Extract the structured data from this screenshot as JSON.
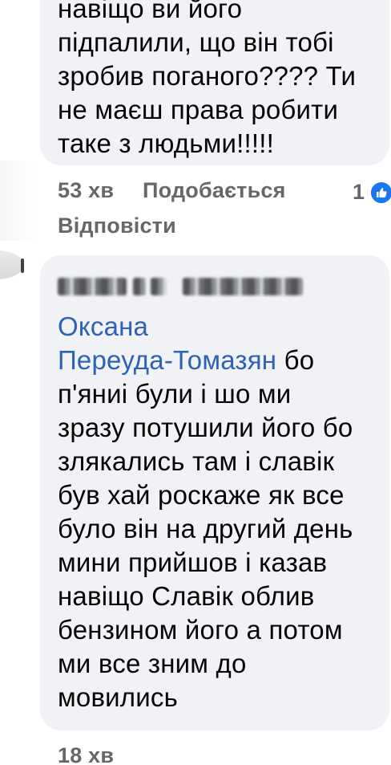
{
  "comment_1": {
    "text": "навіщо ви його\nпідпалили, що він тобі\nзробив поганого???? Ти\nне маєш права робити\nтаке з людьми!!!!!",
    "time": "53 хв",
    "like_label": "Подобається",
    "reply_label": "Відповісти",
    "reaction_count": "1"
  },
  "comment_2": {
    "mention": "Оксана\nПереуда-Томазян",
    "text": " бо\nп'яниі були і шо ми\nзразу потушили його бо\nзлякались там і славік\nбув хай роскаже як все\nбуло він на другий день\nмини прийшов і казав\nнавіщо Славік облив\nбензином його а потом\nми все зним до\nмовились",
    "time": "18 хв"
  },
  "colors": {
    "bubble": "#f0f2f5",
    "text": "#050505",
    "meta": "#65676b",
    "mention": "#2d62b6",
    "like": "#1877f2"
  },
  "icons": {
    "reaction": "like-thumb-icon"
  }
}
